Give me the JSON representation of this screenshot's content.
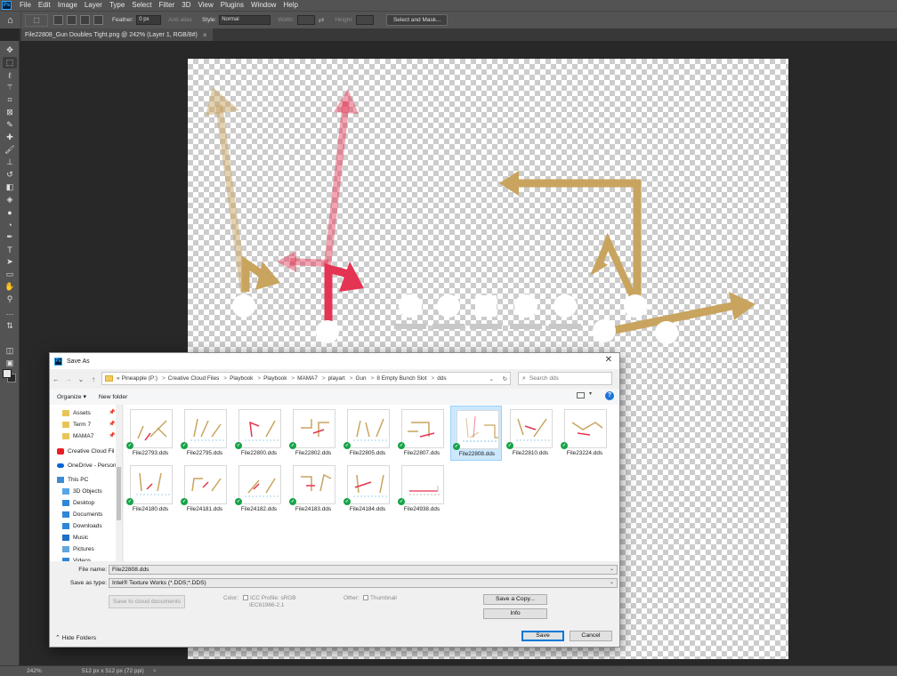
{
  "app": {
    "menu": [
      "File",
      "Edit",
      "Image",
      "Layer",
      "Type",
      "Select",
      "Filter",
      "3D",
      "View",
      "Plugins",
      "Window",
      "Help"
    ]
  },
  "options_bar": {
    "feather_label": "Feather:",
    "feather_value": "0 px",
    "antialias_label": "Anti-alias",
    "style_label": "Style:",
    "style_value": "Normal",
    "width_label": "Width:",
    "height_label": "Height:",
    "select_mask_label": "Select and Mask..."
  },
  "document_tab": {
    "title": "File22808_Gun Doubles Tight.png @ 242% (Layer 1, RGB/8#)",
    "close": "×"
  },
  "status_bar": {
    "zoom": "242%",
    "doc_size": "512 px x 512 px (72 ppi)",
    "arrow": ">"
  },
  "canvas_art": {
    "colors": {
      "gold": "#c8a45f",
      "red": "#e53353",
      "white": "#ffffff",
      "shadow": "#c8c8c8"
    }
  },
  "dialog": {
    "title": "Save As",
    "close": "✕",
    "nav": {
      "back": "←",
      "forward": "→",
      "dropdown": "⌄",
      "up": "↑"
    },
    "address": [
      "«",
      "Pineapple (P:)",
      "Creative Cloud Files",
      "Playbook",
      "Playbook",
      "MAMA7",
      "playart",
      "Gun",
      "8 Empty Bunch Slot",
      "dds"
    ],
    "address_sep": ">",
    "search_placeholder": "Search dds",
    "toolbar": {
      "organize": "Organize ▾",
      "new_folder": "New folder",
      "help": "?"
    },
    "nav_pane": [
      {
        "label": "Assets",
        "icon": "folder-icon",
        "pin": "📌"
      },
      {
        "label": "Term 7",
        "icon": "folder-icon",
        "pin": "📌"
      },
      {
        "label": "MAMA7",
        "icon": "folder-icon",
        "pin": "📌"
      },
      {
        "label": "Creative Cloud Fil",
        "icon": "creative-cloud-icon"
      },
      {
        "label": "OneDrive - Person",
        "icon": "onedrive-icon"
      },
      {
        "label": "This PC",
        "icon": "pc-icon"
      },
      {
        "label": "3D Objects",
        "icon": "3d-objects-icon"
      },
      {
        "label": "Desktop",
        "icon": "desktop-icon"
      },
      {
        "label": "Documents",
        "icon": "documents-icon"
      },
      {
        "label": "Downloads",
        "icon": "downloads-icon"
      },
      {
        "label": "Music",
        "icon": "music-icon"
      },
      {
        "label": "Pictures",
        "icon": "pictures-icon"
      },
      {
        "label": "Videos",
        "icon": "videos-icon"
      }
    ],
    "files": [
      "File22793.dds",
      "File22795.dds",
      "File22800.dds",
      "File22802.dds",
      "File22805.dds",
      "File22807.dds",
      "File22808.dds",
      "File22810.dds",
      "File23224.dds",
      "File24180.dds",
      "File24181.dds",
      "File24182.dds",
      "File24183.dds",
      "File24184.dds",
      "File24938.dds"
    ],
    "selected_file": "File22808.dds",
    "check": "✓",
    "file_name_label": "File name:",
    "file_name_value": "File22808.dds",
    "save_type_label": "Save as type:",
    "save_type_value": "Intel® Texture Works (*.DDS;*.DDS)",
    "cloud_button": "Save to cloud documents",
    "color_label": "Color:",
    "icc_label": "ICC Profile:  sRGB",
    "icc_sub": "IEC61966-2.1",
    "other_label": "Other:",
    "thumbnail_label": "Thumbnail",
    "save_copy": "Save a Copy...",
    "info": "Info",
    "hide_folders": "Hide Folders",
    "save": "Save",
    "cancel": "Cancel",
    "dropdown_glyph": "⌄"
  }
}
